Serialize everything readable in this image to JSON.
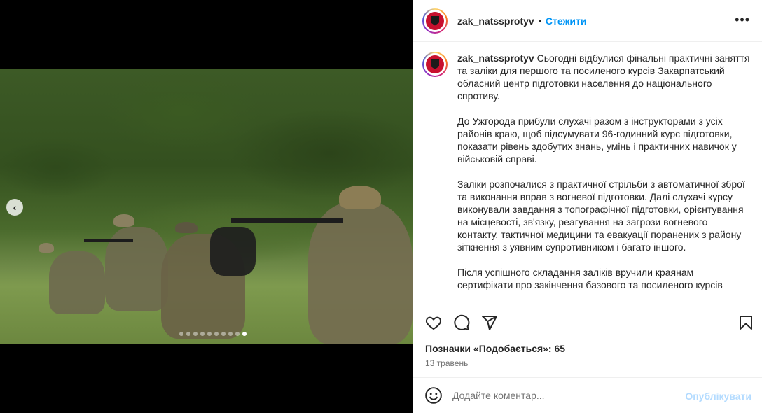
{
  "post": {
    "username": "zak_natssprotyv",
    "separator": "•",
    "follow_label": "Стежити",
    "more_icon": "more-horizontal-icon",
    "carousel": {
      "prev_icon": "chevron-left-icon",
      "slide_count": 10,
      "active_index": 9
    }
  },
  "caption": {
    "username": "zak_natssprotyv",
    "paragraphs": [
      "Сьогодні відбулися фінальні практичні заняття та заліки для першого та посиленого курсів Закарпатський обласний центр підготовки населення до національного спротиву.",
      "До Ужгорода прибули слухачі разом з інструкторами з усіх районів краю, щоб підсумувати 96-годинний курс підготовки, показати рівень здобутих знань, умінь і практичних навичок у військовій справі.",
      "Заліки розпочалися з практичної стрільби з автоматичної зброї та виконання вправ з вогневої підготовки. Далі слухачі курсу виконували завдання з топографічної підготовки, орієнтування на місцевості, зв'язку, реагування на загрози вогневого контакту, тактичної медицини та евакуації поранених з району зіткнення з уявним супротивником і багато іншого.",
      "Після успішного складання заліків вручили краянам сертифікати про закінчення базового та посиленого курсів"
    ]
  },
  "actions": {
    "like_icon": "heart-icon",
    "comment_icon": "comment-icon",
    "share_icon": "send-icon",
    "save_icon": "bookmark-icon"
  },
  "likes_text": "Позначки «Подобається»: 65",
  "date_text": "13 травень",
  "comment": {
    "emoji_icon": "emoji-icon",
    "placeholder": "Додайте коментар...",
    "publish_label": "Опублікувати"
  },
  "colors": {
    "accent": "#0095f6",
    "publish_disabled": "#b3dbff",
    "text": "#262626",
    "secondary": "#737373"
  }
}
